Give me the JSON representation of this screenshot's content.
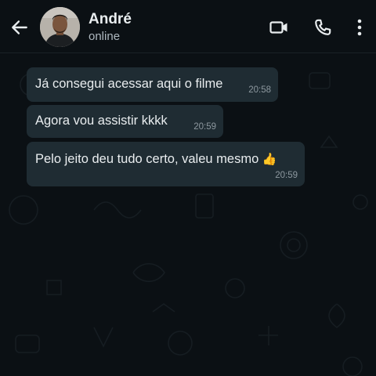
{
  "header": {
    "back_icon": "arrow-left-icon",
    "contact_name": "André",
    "contact_status": "online",
    "video_icon": "video-camera-icon",
    "call_icon": "phone-icon",
    "menu_icon": "more-vertical-icon"
  },
  "messages": [
    {
      "text": "Já consegui acessar aqui o filme",
      "time": "20:58"
    },
    {
      "text": "Agora vou assistir kkkk",
      "time": "20:59"
    },
    {
      "text": "Pelo jeito deu tudo certo, valeu mesmo",
      "emoji": "👍",
      "time": "20:59"
    }
  ],
  "colors": {
    "background": "#0b1014",
    "incoming_bubble": "#1f2c33",
    "text": "#e9edef",
    "secondary_text": "#8d989f"
  }
}
